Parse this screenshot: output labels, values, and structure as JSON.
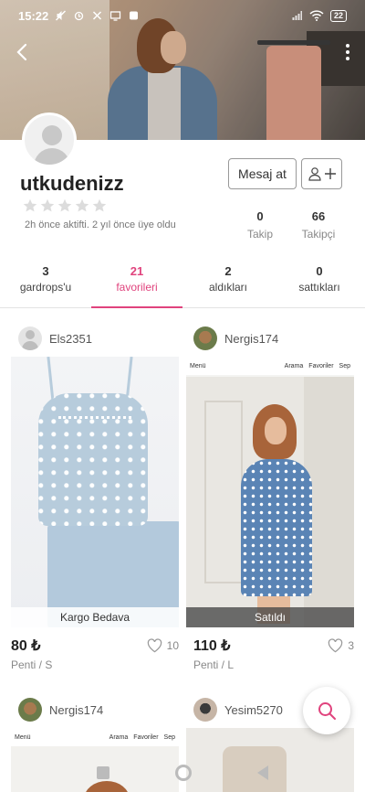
{
  "status_bar": {
    "time": "15:22",
    "battery": "22"
  },
  "profile": {
    "username": "utkudenizz",
    "rating_stars": 0,
    "activity": "2h önce aktifti. 2 yıl önce üye oldu",
    "message_button": "Mesaj at",
    "stats": [
      {
        "value": "0",
        "label": "Takip"
      },
      {
        "value": "66",
        "label": "Takipçi"
      }
    ]
  },
  "tabs": [
    {
      "count": "3",
      "label": "gardrops'u"
    },
    {
      "count": "21",
      "label": "favorileri"
    },
    {
      "count": "2",
      "label": "aldıkları"
    },
    {
      "count": "0",
      "label": "sattıkları"
    }
  ],
  "items": [
    {
      "seller": "Els2351",
      "caption": "Kargo Bedava",
      "price": "80 ₺",
      "likes": "10",
      "brand": "Penti / S"
    },
    {
      "seller": "Nergis174",
      "caption": "Satıldı",
      "price": "110 ₺",
      "likes": "3",
      "brand": "Penti / L",
      "page_bar": {
        "menu": "Menü",
        "search": "Arama",
        "favorites": "Favoriler",
        "cart": "Sep"
      }
    },
    {
      "seller": "Nergis174",
      "page_bar": {
        "menu": "Menü",
        "search": "Arama",
        "favorites": "Favoriler",
        "cart": "Sep"
      }
    },
    {
      "seller": "Yesim5270"
    }
  ],
  "colors": {
    "accent": "#e0437d"
  }
}
